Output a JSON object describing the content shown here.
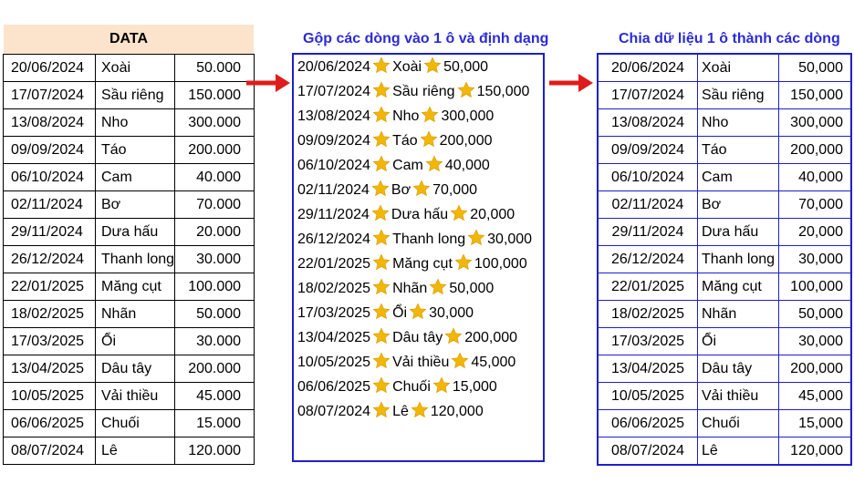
{
  "left_table": {
    "header": "DATA",
    "rows": [
      [
        "20/06/2024",
        "Xoài",
        "50.000"
      ],
      [
        "17/07/2024",
        "Sầu riêng",
        "150.000"
      ],
      [
        "13/08/2024",
        "Nho",
        "300.000"
      ],
      [
        "09/09/2024",
        "Táo",
        "200.000"
      ],
      [
        "06/10/2024",
        "Cam",
        "40.000"
      ],
      [
        "02/11/2024",
        "Bơ",
        "70.000"
      ],
      [
        "29/11/2024",
        "Dưa hấu",
        "20.000"
      ],
      [
        "26/12/2024",
        "Thanh long",
        "30.000"
      ],
      [
        "22/01/2025",
        "Măng cụt",
        "100.000"
      ],
      [
        "18/02/2025",
        "Nhãn",
        "50.000"
      ],
      [
        "17/03/2025",
        "Ổi",
        "30.000"
      ],
      [
        "13/04/2025",
        "Dâu tây",
        "200.000"
      ],
      [
        "10/05/2025",
        "Vải thiều",
        "45.000"
      ],
      [
        "06/06/2025",
        "Chuối",
        "15.000"
      ],
      [
        "08/07/2024",
        "Lê",
        "120.000"
      ]
    ]
  },
  "middle_box": {
    "title": "Gộp các dòng vào 1 ô và định dạng",
    "icon": "star-icon",
    "rows": [
      [
        "20/06/2024",
        "Xoài",
        "50,000"
      ],
      [
        "17/07/2024",
        "Sầu riêng",
        "150,000"
      ],
      [
        "13/08/2024",
        "Nho",
        "300,000"
      ],
      [
        "09/09/2024",
        "Táo",
        "200,000"
      ],
      [
        "06/10/2024",
        "Cam",
        "40,000"
      ],
      [
        "02/11/2024",
        "Bơ",
        "70,000"
      ],
      [
        "29/11/2024",
        "Dưa hấu",
        "20,000"
      ],
      [
        "26/12/2024",
        "Thanh long",
        "30,000"
      ],
      [
        "22/01/2025",
        "Măng cụt",
        "100,000"
      ],
      [
        "18/02/2025",
        "Nhãn",
        "50,000"
      ],
      [
        "17/03/2025",
        "Ổi",
        "30,000"
      ],
      [
        "13/04/2025",
        "Dâu tây",
        "200,000"
      ],
      [
        "10/05/2025",
        "Vải thiều",
        "45,000"
      ],
      [
        "06/06/2025",
        "Chuối",
        "15,000"
      ],
      [
        "08/07/2024",
        "Lê",
        "120,000"
      ]
    ]
  },
  "right_table": {
    "title": "Chia dữ liệu 1 ô thành các dòng",
    "rows": [
      [
        "20/06/2024",
        "Xoài",
        "50,000"
      ],
      [
        "17/07/2024",
        "Sầu riêng",
        "150,000"
      ],
      [
        "13/08/2024",
        "Nho",
        "300,000"
      ],
      [
        "09/09/2024",
        "Táo",
        "200,000"
      ],
      [
        "06/10/2024",
        "Cam",
        "40,000"
      ],
      [
        "02/11/2024",
        "Bơ",
        "70,000"
      ],
      [
        "29/11/2024",
        "Dưa hấu",
        "20,000"
      ],
      [
        "26/12/2024",
        "Thanh long",
        "30,000"
      ],
      [
        "22/01/2025",
        "Măng cụt",
        "100,000"
      ],
      [
        "18/02/2025",
        "Nhãn",
        "50,000"
      ],
      [
        "17/03/2025",
        "Ổi",
        "30,000"
      ],
      [
        "13/04/2025",
        "Dâu tây",
        "200,000"
      ],
      [
        "10/05/2025",
        "Vải thiều",
        "45,000"
      ],
      [
        "06/06/2025",
        "Chuối",
        "15,000"
      ],
      [
        "08/07/2024",
        "Lê",
        "120,000"
      ]
    ]
  },
  "colors": {
    "header_fill": "#fce4cc",
    "title_blue": "#2b2bd6",
    "border_blue": "#1f1fc9",
    "arrow_red": "#e01b1b",
    "star_gold": "#f2b705"
  }
}
